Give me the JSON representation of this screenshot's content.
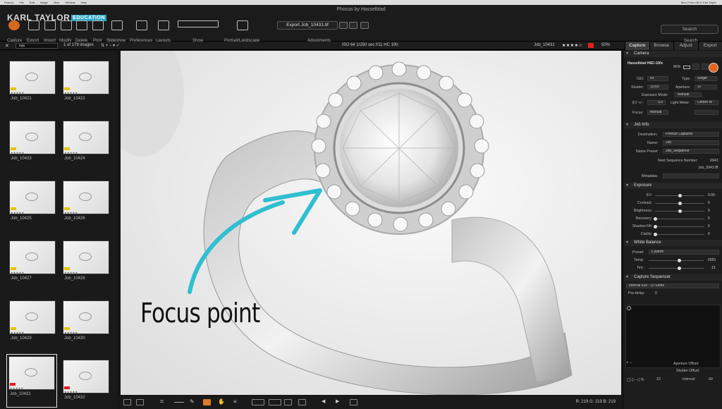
{
  "menubar": {
    "items": [
      "Phocus",
      "File",
      "Edit",
      "Image",
      "View",
      "Window",
      "Help"
    ],
    "right": "Mon 2 Nov 08:11  Karl Taylor"
  },
  "window_title": "Phocus by Hasselblad",
  "watermark": {
    "name": "KARL TAYLOR",
    "badge": "EDUCATION"
  },
  "toolbar": {
    "capture": "Capture",
    "export": "Export",
    "import": "Import",
    "modify": "Modify",
    "delete": "Delete",
    "print": "Print",
    "slideshow": "Slideshow",
    "preferences": "Preferences",
    "layouts": "Layouts",
    "show": "Show",
    "portrait_landscape": "Portrait/Landscape",
    "export_file": "Export Job_10431.tif",
    "adjustments": "Adjustments",
    "search_placeholder": "Search",
    "search_label": "Search"
  },
  "subbar": {
    "filter": "equ",
    "count": "1 of 179 images",
    "exif": "ISO 64   1/250 sec   f/11   HC 100",
    "filename": "Job_10431",
    "stars": "★★★★☆",
    "zoom": "50%"
  },
  "right_tabs": [
    "Capture",
    "Browse",
    "Adjust",
    "Export"
  ],
  "thumbnails": [
    {
      "name": "Job_10421",
      "tag": "yellow"
    },
    {
      "name": "Job_10422",
      "tag": "yellow"
    },
    {
      "name": "Job_10423",
      "tag": "yellow"
    },
    {
      "name": "Job_10424",
      "tag": "yellow"
    },
    {
      "name": "Job_10425",
      "tag": "yellow"
    },
    {
      "name": "Job_10426",
      "tag": "yellow"
    },
    {
      "name": "Job_10427",
      "tag": "yellow"
    },
    {
      "name": "Job_10428",
      "tag": "yellow"
    },
    {
      "name": "Job_10429",
      "tag": "yellow"
    },
    {
      "name": "Job_10430",
      "tag": "yellow"
    },
    {
      "name": "Job_10431",
      "tag": "red"
    },
    {
      "name": "Job_10432",
      "tag": "red"
    }
  ],
  "viewer": {
    "annotation": "Focus point"
  },
  "bottombar": {
    "rgb": "R: 219   G: 219   B: 219"
  },
  "panel": {
    "camera": {
      "title": "Camera",
      "model": "Hasselblad H6D-100c",
      "battery": "86%",
      "iso_label": "ISO:",
      "iso": "64",
      "type_label": "Type:",
      "type": "Single",
      "shutter_label": "Shutter:",
      "shutter": "1/250",
      "aperture_label": "Aperture:",
      "aperture": "11",
      "mode_label": "Exposure Mode:",
      "mode": "Manual",
      "ev_label": "EV +/-:",
      "ev": "0.0",
      "meter_label": "Light Meter:",
      "meter": "Centre W",
      "focus_label": "Focus:",
      "focus": "Manual"
    },
    "job_info": {
      "title": "Job Info",
      "dest_label": "Destination:",
      "dest": "Phocus Captures",
      "name_label": "Name:",
      "name": "Job",
      "preset_label": "Name Preset:",
      "preset": "Job_Sequence",
      "next_label": "Next Sequence Number:",
      "next": "9943",
      "next_file": "Job_9943.fff",
      "metadata_label": "Metadata:"
    },
    "exposure": {
      "title": "Exposure",
      "rows": [
        {
          "label": "EV:",
          "value": "0.00",
          "pos": 0.5
        },
        {
          "label": "Contrast:",
          "value": "0",
          "pos": 0.5
        },
        {
          "label": "Brightness:",
          "value": "0",
          "pos": 0.5
        },
        {
          "label": "Recovery:",
          "value": "0",
          "pos": 0.0
        },
        {
          "label": "Shadow Fill:",
          "value": "0",
          "pos": 0.0
        },
        {
          "label": "Clarity:",
          "value": "0",
          "pos": 0.0
        }
      ]
    },
    "white_balance": {
      "title": "White Balance",
      "preset_label": "Preset:",
      "preset": "Custom",
      "temp_label": "Temp:",
      "temp": "5050",
      "temp_pos": 0.55,
      "tint_label": "Tint:",
      "tint": "13",
      "tint_pos": 0.55
    },
    "sequencer": {
      "title": "Capture Sequencer",
      "preset": "Interval 60s - 10 Shots",
      "predelay_label": "Pre-delay:",
      "predelay": "0",
      "aperture_offset": "Aperture Offset:",
      "shutter_offset": "Shutter Offset:",
      "count": "10",
      "interval_label": "Interval:",
      "interval": "60"
    }
  }
}
